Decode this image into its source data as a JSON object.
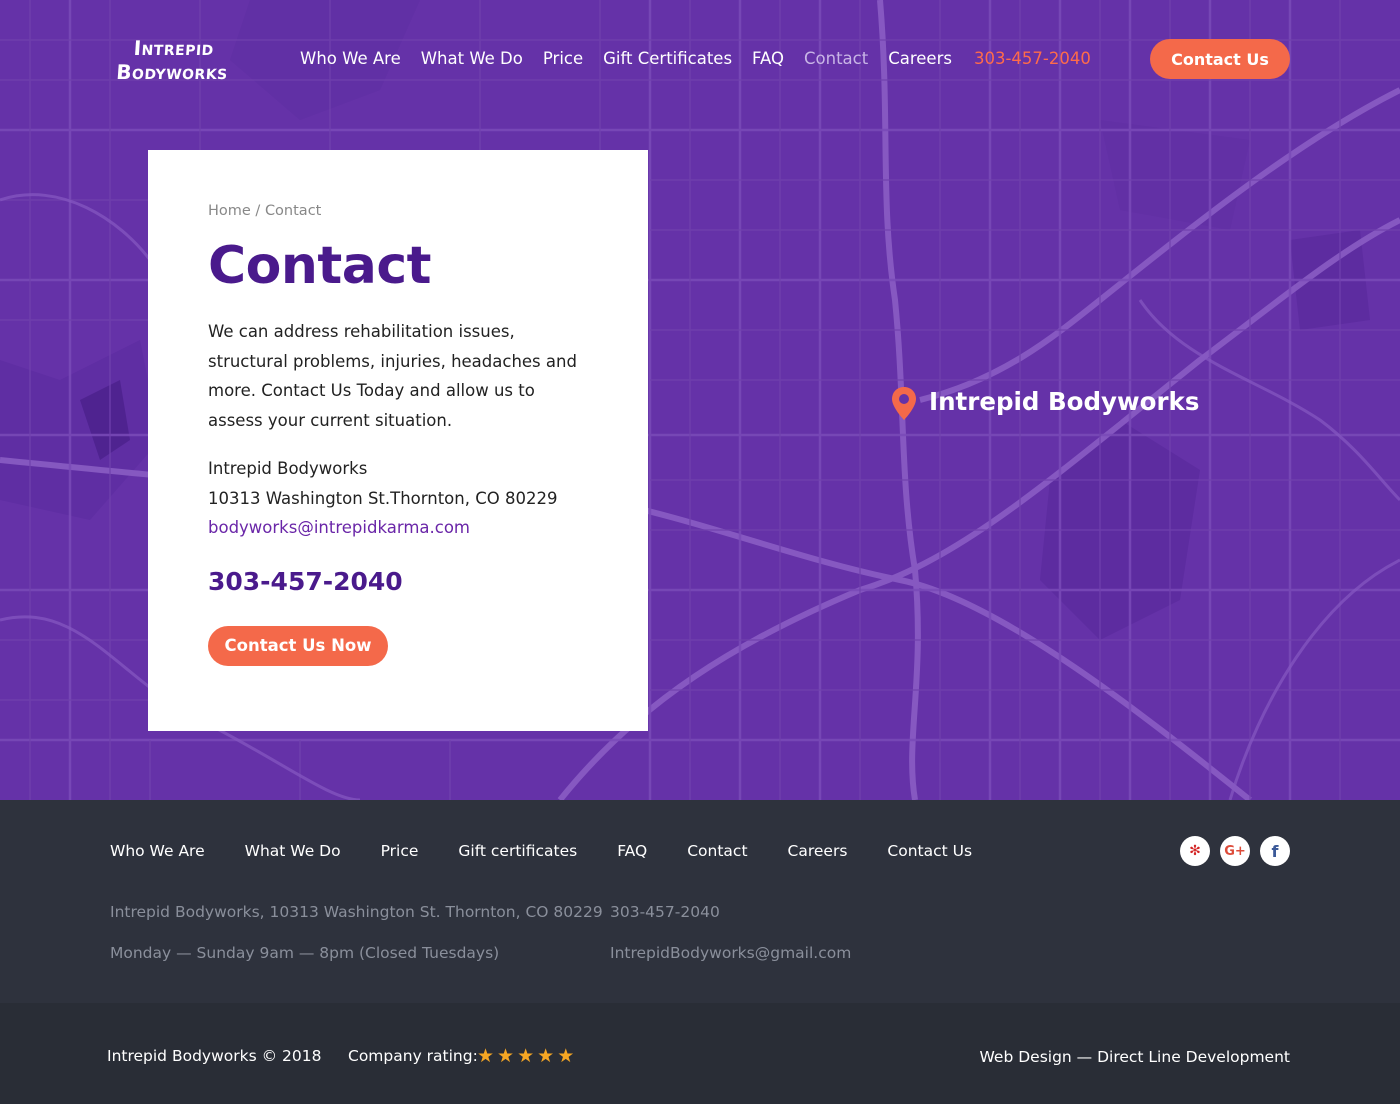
{
  "header": {
    "logo_line1": "Intrepid",
    "logo_line2": "Bodyworks",
    "nav": [
      {
        "label": "Who We Are"
      },
      {
        "label": "What We Do"
      },
      {
        "label": "Price"
      },
      {
        "label": "Gift Certificates"
      },
      {
        "label": "FAQ"
      },
      {
        "label": "Contact"
      },
      {
        "label": "Careers"
      }
    ],
    "phone": "303-457-2040",
    "cta_label": "Contact Us"
  },
  "card": {
    "breadcrumb_home": "Home",
    "breadcrumb_sep": " / ",
    "breadcrumb_current": "Contact",
    "title": "Contact",
    "description": "We can address rehabilitation issues, structural problems, injuries, headaches and more. Contact Us Today and allow us to assess your current situation.",
    "business_name": "Intrepid Bodyworks",
    "address": "10313 Washington St.Thornton, CO 80229",
    "email": "bodyworks@intrepidkarma.com",
    "phone": "303-457-2040",
    "button_label": "Contact Us Now"
  },
  "map": {
    "pin_label": "Intrepid Bodyworks",
    "pin_icon": "map-pin-icon"
  },
  "footer": {
    "nav": [
      {
        "label": "Who We Are"
      },
      {
        "label": "What We Do"
      },
      {
        "label": "Price"
      },
      {
        "label": "Gift certificates"
      },
      {
        "label": "FAQ"
      },
      {
        "label": "Contact"
      },
      {
        "label": "Careers"
      },
      {
        "label": "Contact Us"
      }
    ],
    "social": [
      {
        "name": "yelp-icon",
        "glyph": "✻"
      },
      {
        "name": "google-plus-icon",
        "glyph": "G+"
      },
      {
        "name": "facebook-icon",
        "glyph": "f"
      }
    ],
    "address": "Intrepid Bodyworks, 10313 Washington St. Thornton, CO 80229",
    "hours": "Monday — Sunday 9am — 8pm (Closed Tuesdays)",
    "phone": "303-457-2040",
    "email": "IntrepidBodyworks@gmail.com"
  },
  "bottom": {
    "copyright": "Intrepid Bodyworks © 2018",
    "rating_label": "Company rating:",
    "rating": 5,
    "rating_max": 5,
    "credit": "Web Design — Direct Line Development"
  },
  "colors": {
    "primary_purple": "#6532a8",
    "heading_purple": "#4a1a8c",
    "accent_orange": "#f4694a",
    "footer_bg": "#2e323d",
    "star": "#f5a623"
  }
}
